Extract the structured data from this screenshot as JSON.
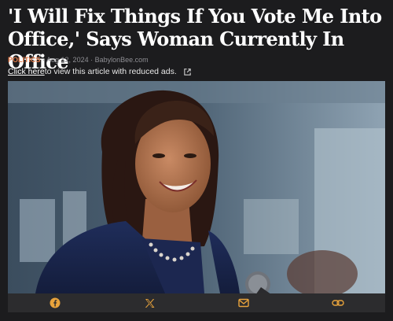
{
  "article": {
    "headline": "'I Will Fix Things If You Vote Me Into Office,' Says Woman Currently In Office",
    "category": "POLITICS",
    "separator": " · ",
    "date": "Aug 12, 2024",
    "source": "BabylonBee.com"
  },
  "reduced_ads": {
    "link_text": "Click here",
    "rest_text": " to view this article with reduced ads."
  },
  "share_bar": {
    "buttons": [
      {
        "icon": "facebook-icon"
      },
      {
        "icon": "x-icon"
      },
      {
        "icon": "email-icon"
      },
      {
        "icon": "link-icon"
      }
    ]
  },
  "colors": {
    "background": "#1c1c1e",
    "category": "#e07a4a",
    "share_icons": "#e8a33c",
    "share_bar": "#2c2c2e"
  }
}
